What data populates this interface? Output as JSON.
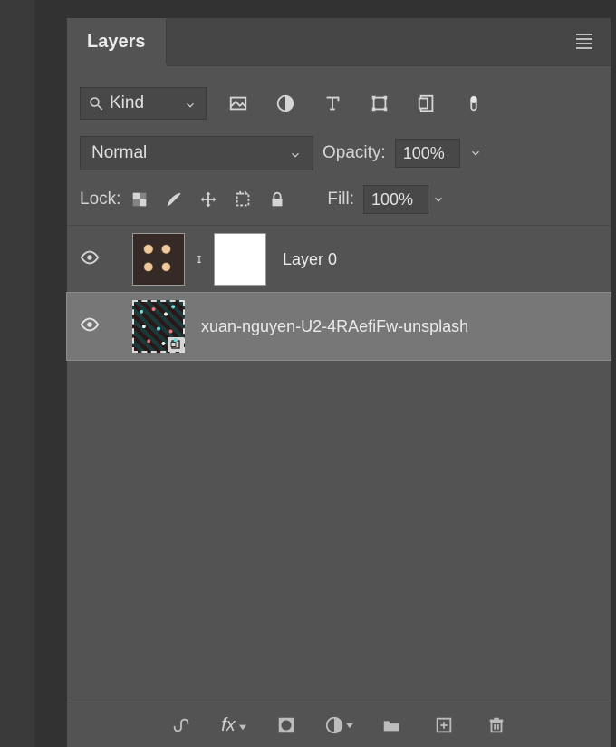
{
  "panel": {
    "title": "Layers",
    "filter": {
      "mode": "Kind"
    },
    "blend_mode": "Normal",
    "opacity_label": "Opacity:",
    "opacity_value": "100%",
    "lock_label": "Lock:",
    "fill_label": "Fill:",
    "fill_value": "100%"
  },
  "layers": [
    {
      "name": "Layer 0",
      "selected": false
    },
    {
      "name": "xuan-nguyen-U2-4RAefiFw-unsplash",
      "selected": true
    }
  ],
  "icons": {
    "menu": "panel-menu",
    "search": "search",
    "image": "image-filter",
    "adjust": "adjustment-filter",
    "type": "type-filter",
    "shape": "shape-filter",
    "smart": "smartobject-filter",
    "dot": "artboard-filter",
    "checker": "lock-transparency",
    "brush": "lock-pixels",
    "move": "lock-position",
    "crop": "lock-artboard",
    "lock": "lock-all",
    "link": "link-layers",
    "fx": "layer-effects",
    "mask": "add-mask",
    "adj": "new-adjustment-layer",
    "folder": "new-group",
    "new": "new-layer",
    "trash": "delete-layer"
  },
  "fx_label": "fx"
}
